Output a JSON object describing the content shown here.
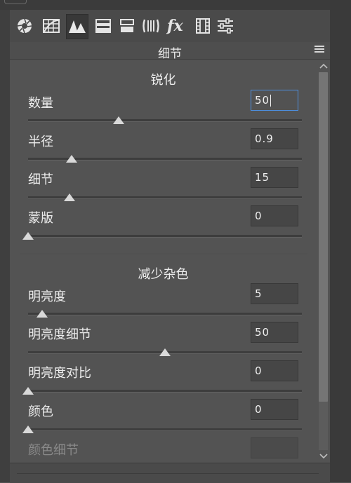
{
  "tabs": [
    {
      "name": "tab-basic",
      "icon": "aperture-icon",
      "active": false
    },
    {
      "name": "tab-tone-curve",
      "icon": "grid-curve-icon",
      "active": false
    },
    {
      "name": "tab-detail",
      "icon": "mountain-triangles-icon",
      "active": true
    },
    {
      "name": "tab-hsl",
      "icon": "split-bars-icon",
      "active": false
    },
    {
      "name": "tab-split-toning",
      "icon": "split-toning-icon",
      "active": false
    },
    {
      "name": "tab-lens-corrections",
      "icon": "lens-icon",
      "active": false
    },
    {
      "name": "tab-effects",
      "icon": "fx-icon",
      "active": false
    },
    {
      "name": "tab-camera-calibration",
      "icon": "film-strip-icon",
      "active": false
    },
    {
      "name": "tab-presets",
      "icon": "sliders-icon",
      "active": false
    }
  ],
  "panel": {
    "title": "细节"
  },
  "sharpening": {
    "title": "锐化",
    "rows": [
      {
        "label": "数量",
        "value": "50",
        "level": 0.33
      },
      {
        "label": "半径",
        "value": "0.9",
        "level": 0.16
      },
      {
        "label": "细节",
        "value": "15",
        "level": 0.15
      },
      {
        "label": "蒙版",
        "value": "0",
        "level": 0.0
      }
    ]
  },
  "noise_reduction": {
    "title": "减少杂色",
    "rows": [
      {
        "label": "明亮度",
        "value": "5",
        "level": 0.05
      },
      {
        "label": "明亮度细节",
        "value": "50",
        "level": 0.5
      },
      {
        "label": "明亮度对比",
        "value": "0",
        "level": 0.0
      },
      {
        "label": "颜色",
        "value": "0",
        "level": 0.0
      },
      {
        "label": "颜色细节",
        "value": "",
        "level": null
      }
    ]
  },
  "scroll_position": 0.0
}
